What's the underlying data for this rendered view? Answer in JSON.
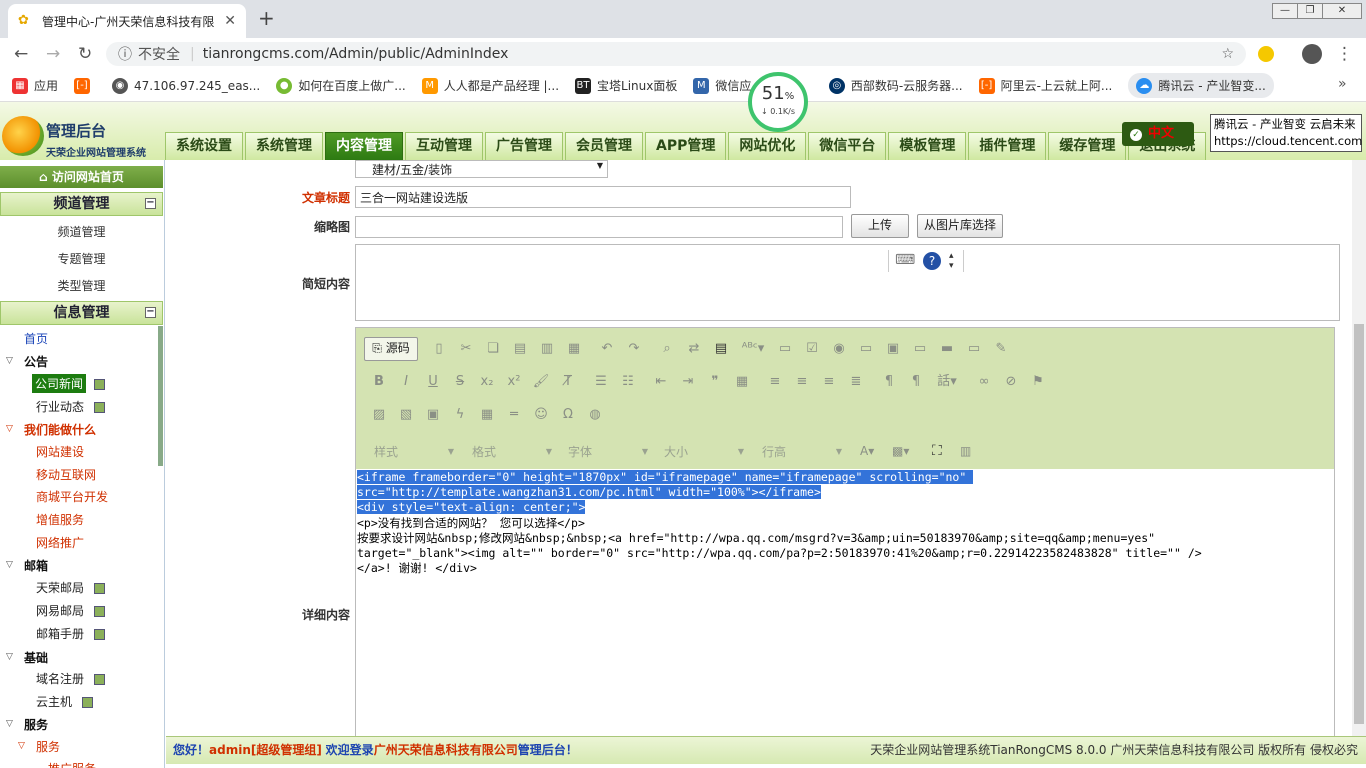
{
  "browser": {
    "tab_title": "管理中心-广州天荣信息科技有限",
    "not_secure": "不安全",
    "url": "tianrongcms.com/Admin/public/AdminIndex",
    "bookmarks": [
      {
        "label": "应用"
      },
      {
        "label": ""
      },
      {
        "label": "47.106.97.245_eas..."
      },
      {
        "label": "如何在百度上做广..."
      },
      {
        "label": "人人都是产品经理 |..."
      },
      {
        "label": "宝塔Linux面板"
      },
      {
        "label": "微信应..."
      },
      {
        "label": "西部数码-云服务器..."
      },
      {
        "label": "阿里云-上云就上阿..."
      },
      {
        "label": "腾讯云 - 产业智变..."
      }
    ],
    "speed_percent": "51",
    "speed_unit": "%",
    "speed_rate": "↓ 0.1K/s",
    "tooltip_line1": "腾讯云 - 产业智变 云启未来",
    "tooltip_line2": "https://cloud.tencent.com"
  },
  "header": {
    "logo_title": "管理后台",
    "logo_subtitle": "天荣企业网站管理系统",
    "menu": [
      "系统设置",
      "系统管理",
      "内容管理",
      "互动管理",
      "广告管理",
      "会员管理",
      "APP管理",
      "网站优化",
      "微信平台",
      "模板管理",
      "插件管理",
      "缓存管理",
      "退出系统"
    ],
    "active_menu": "内容管理",
    "lang": "中文"
  },
  "sidebar": {
    "visit_home": "访问网站首页",
    "channel_title": "频道管理",
    "channel_items": [
      "频道管理",
      "专题管理",
      "类型管理"
    ],
    "info_title": "信息管理",
    "tree": {
      "home": "首页",
      "notice": "公告",
      "company_news": "公司新闻",
      "industry_news": "行业动态",
      "what_we_do": "我们能做什么",
      "website": "网站建设",
      "mobile": "移动互联网",
      "mall": "商城平台开发",
      "value_added": "增值服务",
      "promotion": "网络推广",
      "mail": "邮箱",
      "tianrong_mail": "天荣邮局",
      "netease_mail": "网易邮局",
      "mail_manual": "邮箱手册",
      "basic": "基础",
      "domain": "域名注册",
      "cloud_host": "云主机",
      "service": "服务",
      "service_sub": "服务",
      "service_more": "推广服务"
    }
  },
  "form": {
    "category_value": "建材/五金/装饰",
    "title_label": "文章标题",
    "title_value": "三合一网站建设选版",
    "thumb_label": "缩略图",
    "upload_btn": "上传",
    "gallery_btn": "从图片库选择",
    "brief_label": "简短内容",
    "detail_label": "详细内容",
    "source_btn": "源码",
    "style_dd": "样式",
    "format_dd": "格式",
    "font_dd": "字体",
    "size_dd": "大小",
    "lineheight_dd": "行高",
    "code_lines": [
      "<iframe frameborder=\"0\" height=\"1870px\" id=\"iframepage\" name=\"iframepage\" scrolling=\"no\" ",
      "src=\"http://template.wangzhan31.com/pc.html\" width=\"100%\"></iframe>",
      "<div style=\"text-align: center;\">",
      "<p>没有找到合适的网站？ 您可以选择</p>",
      "按要求设计网站&nbsp;修改网站&nbsp;&nbsp;<a href=\"http://wpa.qq.com/msgrd?v=3&amp;uin=50183970&amp;site=qq&amp;menu=yes\"",
      "target=\"_blank\"><img alt=\"\" border=\"0\" src=\"http://wpa.qq.com/pa?p=2:50183970:41%20&amp;r=0.22914223582483828\" title=\"\" />",
      "</a>! 谢谢! </div>"
    ]
  },
  "footer": {
    "hello": "您好！",
    "user": "admin[超级管理组]",
    "welcome": "欢迎登录",
    "company": "广州天荣信息科技有限公司",
    "backend": "管理后台！",
    "right": "天荣企业网站管理系统TianRongCMS 8.0.0  广州天荣信息科技有限公司 版权所有 侵权必究"
  },
  "colors": {
    "accent_green": "#2d7a12",
    "label_red": "#d03000",
    "selection": "#3373d9"
  }
}
